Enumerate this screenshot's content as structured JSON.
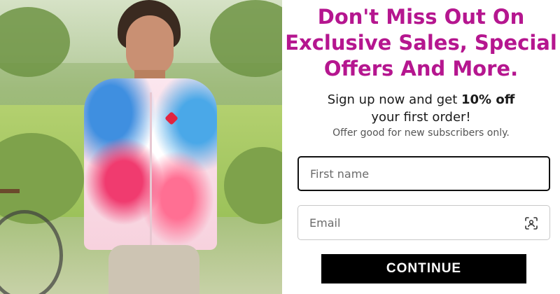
{
  "popup": {
    "headline_line1": "Don't Miss Out On",
    "headline_line2": "Exclusive Sales, Special",
    "headline_line3": "Offers And More.",
    "signup_prefix": "Sign up now and get ",
    "signup_bold": "10% off",
    "signup_suffix": "your first order!",
    "note": "Offer good for new subscribers only.",
    "first_name_placeholder": "First name",
    "first_name_value": "",
    "email_placeholder": "Email",
    "email_value": "",
    "continue_label": "CONTINUE"
  },
  "icons": {
    "email_field_icon": "contact-scan-icon"
  },
  "colors": {
    "headline": "#b5168f",
    "button_bg": "#000000",
    "button_text": "#ffffff",
    "active_field_border": "#111111",
    "field_border": "#c8c8c8"
  },
  "image": {
    "subject": "woman-cyclist-photo"
  }
}
